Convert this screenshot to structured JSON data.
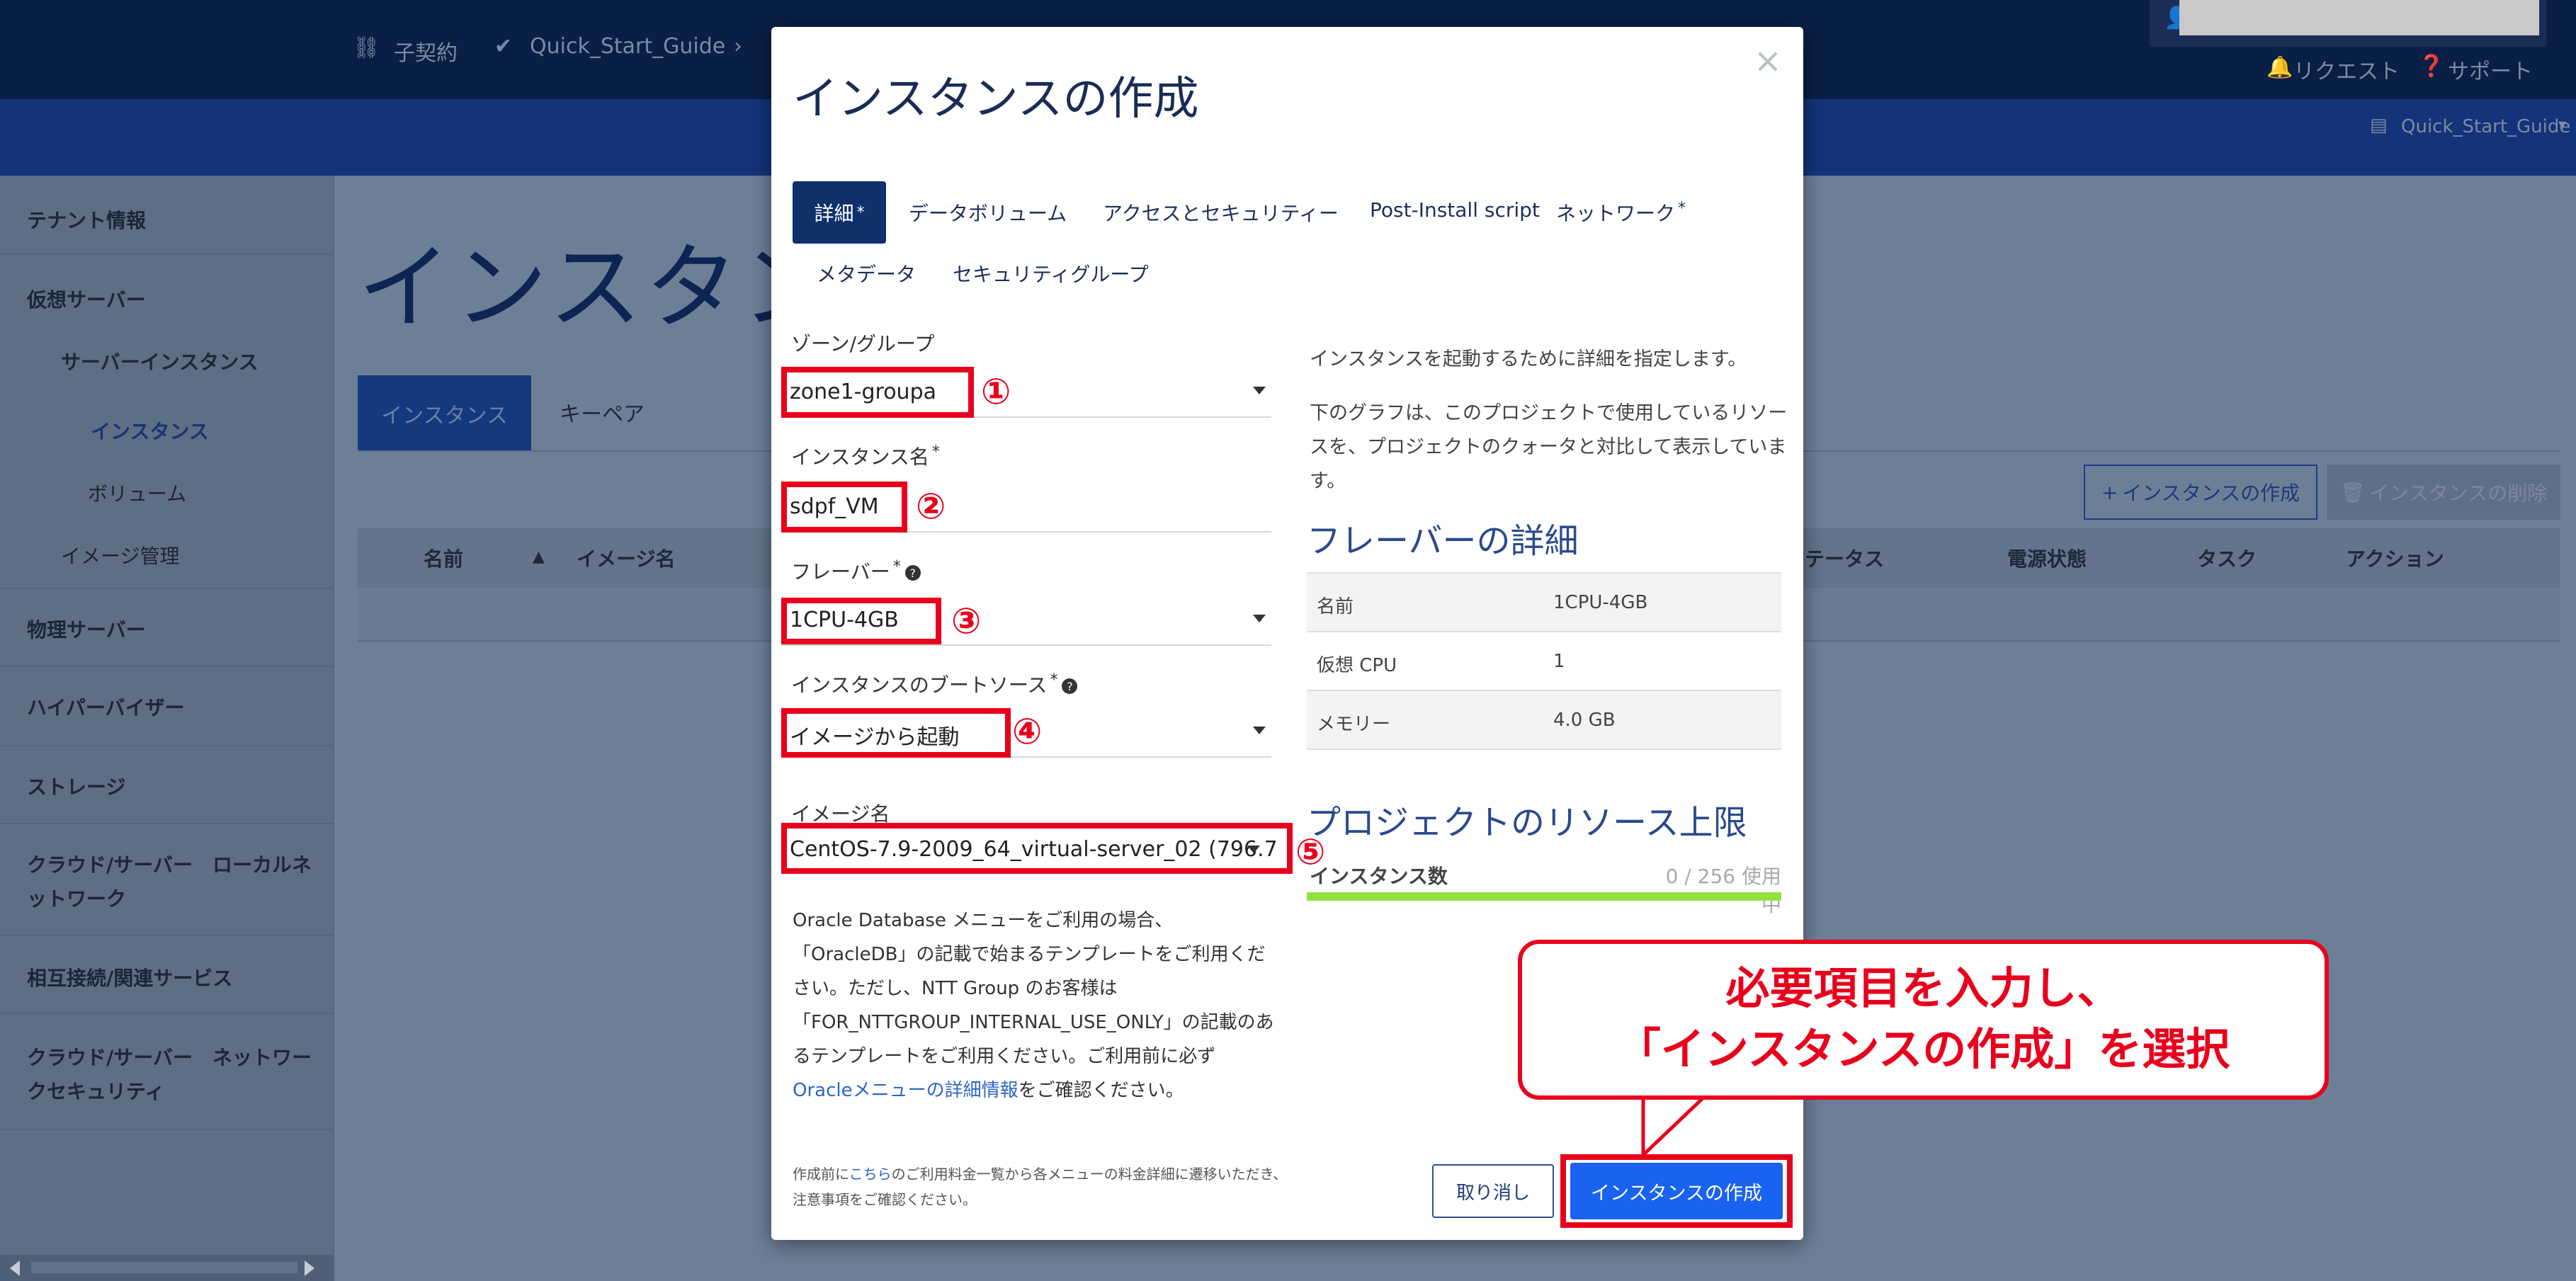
{
  "background": {
    "topbar": {
      "contract_label": "子契約",
      "project_label": "Quick_Start_Guide",
      "request_label": "リクエスト",
      "support_label": "サポート",
      "project_selector": "Quick_Start_Guide"
    },
    "sidebar": {
      "tenant_info": "テナント情報",
      "virtual_server": "仮想サーバー",
      "server_instance": "サーバーインスタンス",
      "instances": "インスタンス",
      "volumes": "ボリューム",
      "image_management": "イメージ管理",
      "physical_server": "物理サーバー",
      "hypervisor": "ハイパーバイザー",
      "storage": "ストレージ",
      "cloud_local_network_line1": "クラウド/サーバー　ローカルネ",
      "cloud_local_network_line2": "ットワーク",
      "interconnect": "相互接続/関連サービス",
      "cloud_network_security_line1": "クラウド/サーバー　ネットワー",
      "cloud_network_security_line2": "クセキュリティ"
    },
    "main": {
      "title": "インスタン",
      "tab_instances": "インスタンス",
      "tab_keypair": "キーペア",
      "create_button": "インスタンスの作成",
      "delete_button": "インスタンスの削除",
      "columns": [
        "名前",
        "イメージ名",
        "テータス",
        "電源状態",
        "タスク",
        "アクション"
      ]
    }
  },
  "modal": {
    "title": "インスタンスの作成",
    "close_glyph": "×",
    "tabs": {
      "details": "詳細",
      "data_volume": "データボリューム",
      "access_security": "アクセスとセキュリティー",
      "post_install": "Post-Install script",
      "network": "ネットワーク",
      "metadata": "メタデータ",
      "security_group": "セキュリティグループ",
      "required_mark": "*"
    },
    "fields": {
      "zone_label": "ゾーン/グループ",
      "zone_value": "zone1-groupa",
      "name_label": "インスタンス名",
      "name_value": "sdpf_VM",
      "flavor_label": "フレーバー",
      "flavor_value": "1CPU-4GB",
      "boot_label": "インスタンスのブートソース",
      "boot_value": "イメージから起動",
      "image_label": "イメージ名",
      "image_value": "CentOS-7.9-2009_64_virtual-server_02 (796.7",
      "help_glyph": "?"
    },
    "markers": [
      "①",
      "②",
      "③",
      "④",
      "⑤"
    ],
    "note": {
      "line1": "Oracle Database メニューをご利用の場合、",
      "line2": "「OracleDB」の記載で始まるテンプレートをご利用くだ",
      "line3": "さい。ただし、NTT Group のお客様は",
      "line4": "「FOR_NTTGROUP_INTERNAL_USE_ONLY」の記載のあ",
      "line5": "るテンプレートをご利用ください。ご利用前に必ず",
      "link": "Oracleメニューの詳細情報",
      "line6_tail": "をご確認ください。"
    },
    "footer_note": {
      "prefix": "作成前に",
      "link": "こちら",
      "suffix": "のご利用料金一覧から各メニューの料金詳細に遷移いただき、",
      "line2": "注意事項をご確認ください。"
    },
    "right": {
      "desc1": "インスタンスを起動するために詳細を指定します。",
      "desc2_line1": "下のグラフは、このプロジェクトで使用しているリソー",
      "desc2_line2": "スを、プロジェクトのクォータと対比して表示していま",
      "desc2_line3": "す。",
      "flavor_title": "フレーバーの詳細",
      "flavor_rows": [
        {
          "key": "名前",
          "value": "1CPU-4GB"
        },
        {
          "key": "仮想 CPU",
          "value": "1"
        },
        {
          "key": "メモリー",
          "value": "4.0 GB"
        }
      ],
      "quota_title": "プロジェクトのリソース上限",
      "quota_label": "インスタンス数",
      "quota_value": "0 / 256 使用中",
      "quota_fraction": 0.0
    },
    "buttons": {
      "cancel": "取り消し",
      "create": "インスタンスの作成"
    }
  },
  "callout": {
    "line1": "必要項目を入力し、",
    "line2": "「インスタンスの作成」を選択"
  },
  "colors": {
    "annotation_red": "#e8001c",
    "primary_blue": "#1a62f0",
    "navy": "#10306c",
    "quota_green": "#94e03d"
  }
}
